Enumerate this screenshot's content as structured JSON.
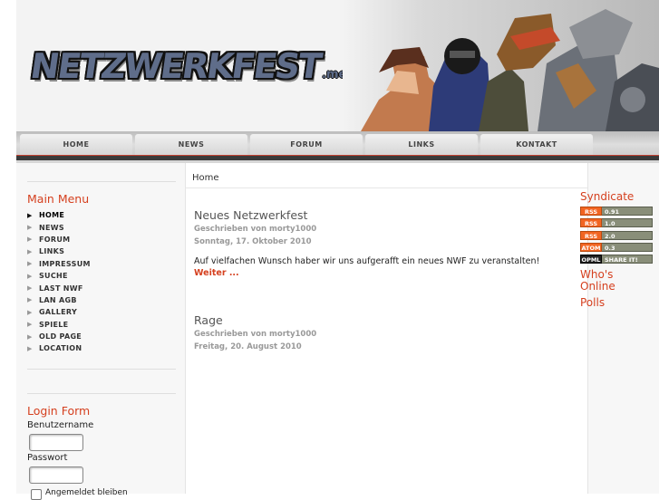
{
  "header": {
    "logo_main": "NETZWERKFEST",
    "logo_suffix": ".me"
  },
  "nav": [
    {
      "label": "HOME"
    },
    {
      "label": "NEWS"
    },
    {
      "label": "FORUM"
    },
    {
      "label": "LINKS"
    },
    {
      "label": "KONTAKT"
    }
  ],
  "main_menu": {
    "title": "Main Menu",
    "items": [
      {
        "label": "HOME",
        "active": true
      },
      {
        "label": "NEWS"
      },
      {
        "label": "FORUM"
      },
      {
        "label": "LINKS"
      },
      {
        "label": "IMPRESSUM"
      },
      {
        "label": "SUCHE"
      },
      {
        "label": "LAST NWF"
      },
      {
        "label": "LAN AGB"
      },
      {
        "label": "GALLERY"
      },
      {
        "label": "SPIELE"
      },
      {
        "label": "OLD PAGE"
      },
      {
        "label": "LOCATION"
      }
    ]
  },
  "login": {
    "title": "Login Form",
    "username_label": "Benutzername",
    "password_label": "Passwort",
    "remember_label": "Angemeldet bleiben"
  },
  "breadcrumb": "Home",
  "articles": [
    {
      "title": "Neues Netzwerkfest",
      "author": "Geschrieben von morty1000",
      "date": "Sonntag, 17. Oktober 2010",
      "body": "Auf vielfachen Wunsch haber wir uns aufgerafft ein neues NWF zu veranstalten!",
      "readmore": "Weiter ..."
    },
    {
      "title": "Rage",
      "author": "Geschrieben von morty1000",
      "date": "Freitag, 20. August 2010"
    }
  ],
  "right": {
    "syndicate_title": "Syndicate",
    "feeds": [
      {
        "left": "RSS",
        "right": "0.91"
      },
      {
        "left": "RSS",
        "right": "1.0"
      },
      {
        "left": "RSS",
        "right": "2.0"
      },
      {
        "left": "ATOM",
        "right": "0.3"
      },
      {
        "left": "OPML",
        "right": "SHARE IT!"
      }
    ],
    "whos_online": "Who's Online",
    "polls": "Polls"
  },
  "colors": {
    "accent": "#d5401f",
    "rss_orange": "#f26522"
  }
}
